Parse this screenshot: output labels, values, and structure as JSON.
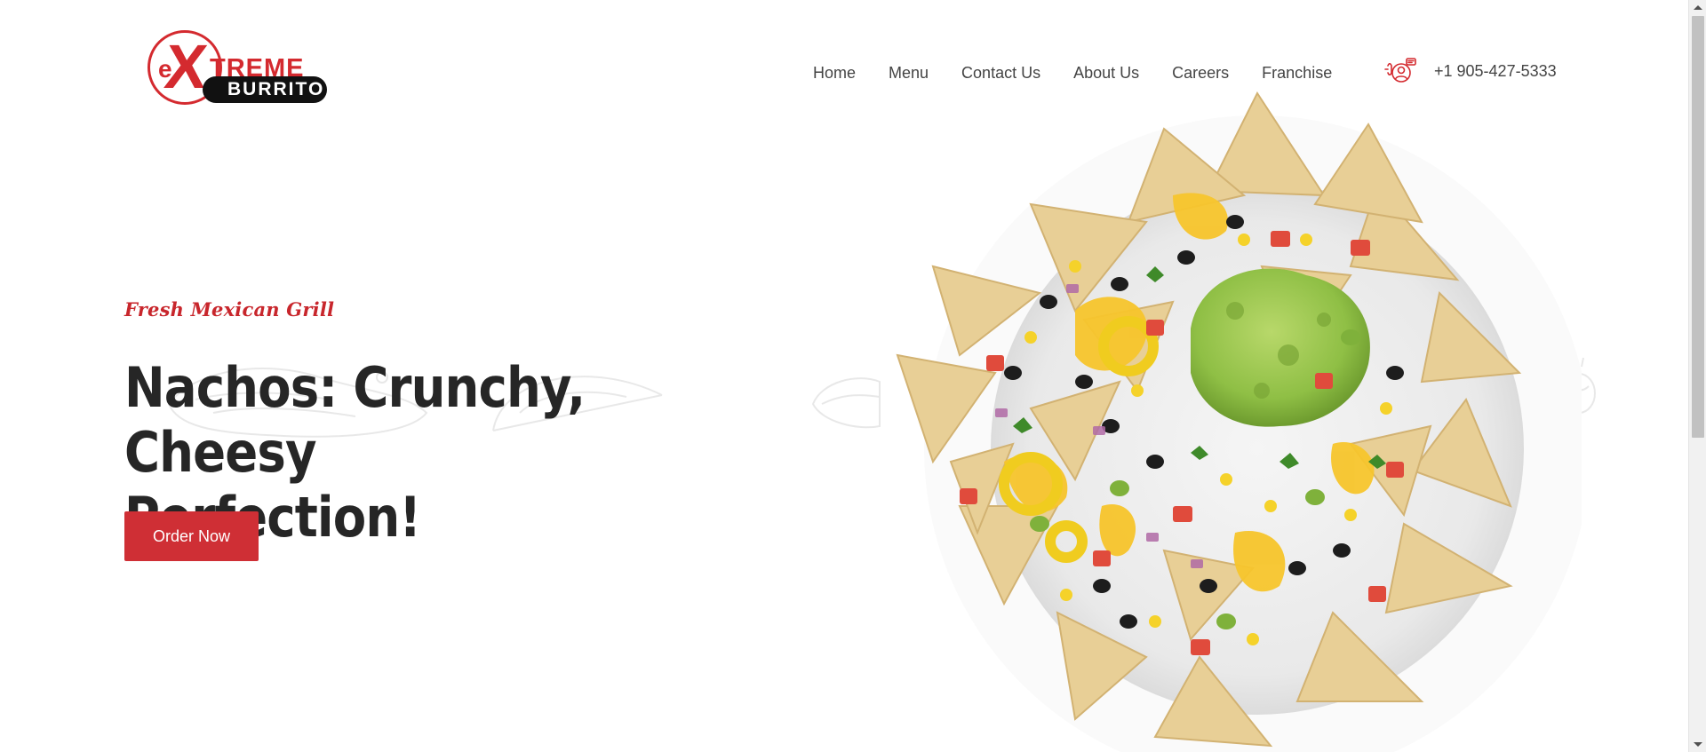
{
  "brand": {
    "logo_prefix": "e",
    "logo_x": "X",
    "logo_suffix": "TREME",
    "logo_sub": "BURRITO",
    "brand_color": "#d42a2f"
  },
  "nav": {
    "items": [
      {
        "label": "Home"
      },
      {
        "label": "Menu"
      },
      {
        "label": "Contact Us"
      },
      {
        "label": "About Us"
      },
      {
        "label": "Careers"
      },
      {
        "label": "Franchise"
      }
    ]
  },
  "contact": {
    "phone_icon": "delivery-phone-icon",
    "phone": "+1 905-427-5333"
  },
  "hero": {
    "tagline": "Fresh Mexican Grill",
    "headline_line1": "Nachos: Crunchy, Cheesy",
    "headline_line2": "Perfection!",
    "cta_label": "Order Now",
    "accent_color": "#cf2f35",
    "image": "nachos-plate-image"
  }
}
